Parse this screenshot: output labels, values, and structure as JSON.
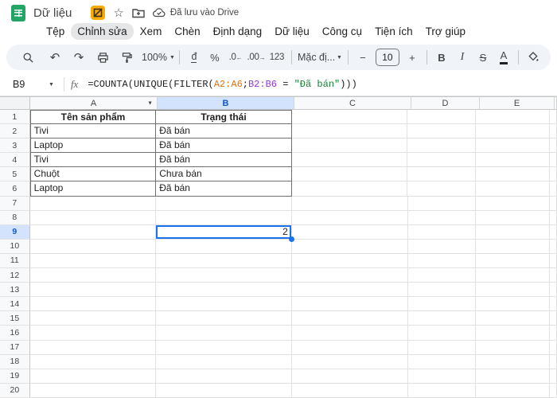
{
  "titlebar": {
    "title": "Dữ liệu",
    "saved_status": "Đã lưu vào Drive"
  },
  "menu": {
    "items": [
      "Tệp",
      "Chỉnh sửa",
      "Xem",
      "Chèn",
      "Định dạng",
      "Dữ liệu",
      "Công cụ",
      "Tiện ích",
      "Trợ giúp"
    ],
    "active_item": "Chỉnh sửa"
  },
  "toolbar": {
    "zoom": "100%",
    "currency": "đ",
    "percent": "%",
    "decrease_decimal": ".0",
    "decrease_decimal_arrow": "←",
    "increase_decimal": ".00",
    "increase_decimal_arrow": "→",
    "more_formats": "123",
    "font_name": "Mặc đị...",
    "decrease_size": "−",
    "font_size": "10",
    "increase_size": "+",
    "bold": "B",
    "italic": "I",
    "strikethrough": "S",
    "text_color": "A",
    "undo": "↶",
    "redo": "↷"
  },
  "formula_bar": {
    "name_box": "B9",
    "fx_label": "fx",
    "formula": {
      "pre": "=COUNTA(UNIQUE(FILTER(",
      "range1": "A2:A6",
      "sep": ";",
      "range2": "B2:B6",
      "operator": " = ",
      "string": "\"Đã bán\"",
      "post": ")))"
    }
  },
  "grid": {
    "columns": [
      "A",
      "B",
      "C",
      "D",
      "E"
    ],
    "selected_column": "B",
    "selected_row": 9,
    "row_count": 20,
    "table_border": {
      "columns": [
        "A",
        "B"
      ],
      "rows": [
        1,
        6
      ]
    },
    "cells": [
      {
        "row": 1,
        "col": "A",
        "text": "Tên sản phẩm",
        "bold": true,
        "align": "center"
      },
      {
        "row": 1,
        "col": "B",
        "text": "Trạng thái",
        "bold": true,
        "align": "center"
      },
      {
        "row": 2,
        "col": "A",
        "text": "Tivi"
      },
      {
        "row": 2,
        "col": "B",
        "text": "Đã bán"
      },
      {
        "row": 3,
        "col": "A",
        "text": "Laptop"
      },
      {
        "row": 3,
        "col": "B",
        "text": "Đã bán"
      },
      {
        "row": 4,
        "col": "A",
        "text": "Tivi"
      },
      {
        "row": 4,
        "col": "B",
        "text": "Đã bán"
      },
      {
        "row": 5,
        "col": "A",
        "text": "Chuột"
      },
      {
        "row": 5,
        "col": "B",
        "text": "Chưa bán"
      },
      {
        "row": 6,
        "col": "A",
        "text": "Laptop"
      },
      {
        "row": 6,
        "col": "B",
        "text": "Đã bán"
      },
      {
        "row": 9,
        "col": "B",
        "text": "2",
        "align": "right",
        "selected": true
      }
    ]
  },
  "colors": {
    "accent_blue": "#1a73e8",
    "selected_header_bg": "#d3e3fd",
    "selected_header_text": "#0b57d0",
    "toolbar_bg": "#f0f4f9",
    "logo_green": "#23a566",
    "badge_yellow": "#f9ab00",
    "formula_range1": "#e8710a",
    "formula_range2": "#9334e6",
    "formula_string": "#188038",
    "table_border": "#6f6f6f"
  }
}
